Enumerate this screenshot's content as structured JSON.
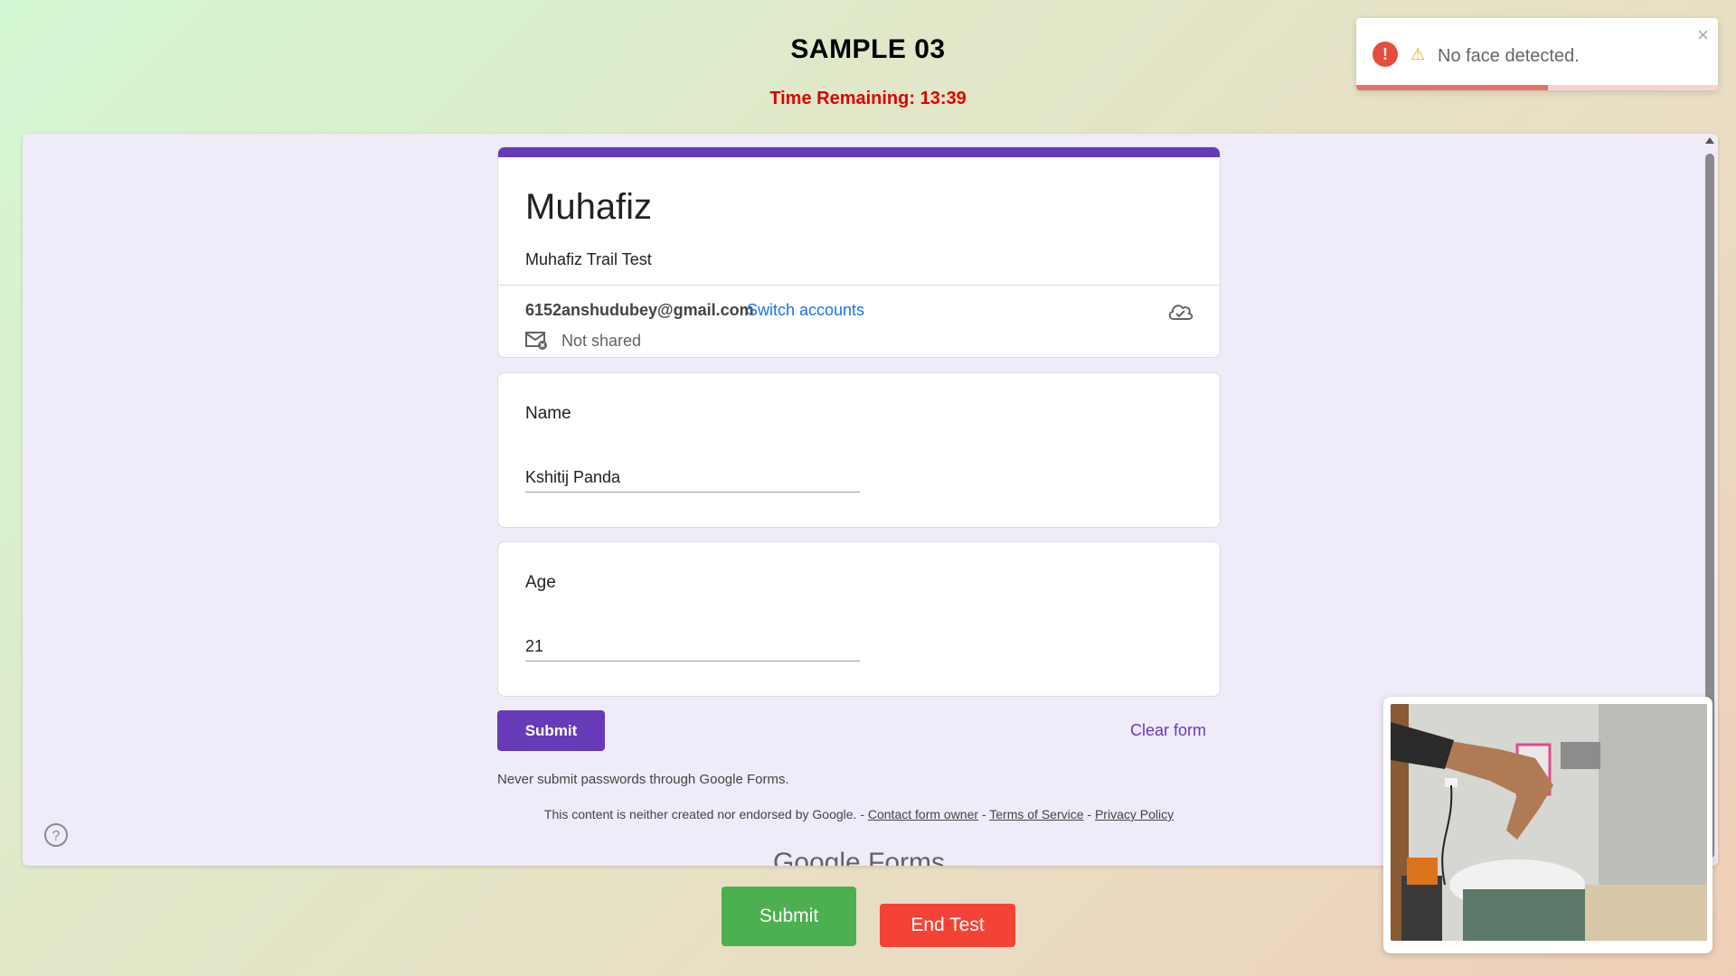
{
  "header": {
    "title": "SAMPLE 03",
    "timer": "Time Remaining: 13:39"
  },
  "toast": {
    "message": "No face detected.",
    "close": "×",
    "error_glyph": "!",
    "warning_glyph": "⚠",
    "progress": 0.53
  },
  "form": {
    "title": "Muhafiz",
    "description": "Muhafiz Trail Test",
    "email": "6152anshudubey@gmail.com",
    "switch_accounts": "Switch accounts",
    "not_shared": "Not shared",
    "questions": [
      {
        "label": "Name",
        "value": "Kshitij Panda"
      },
      {
        "label": "Age",
        "value": "21"
      }
    ],
    "submit_label": "Submit",
    "clear_label": "Clear form",
    "never_submit": "Never submit passwords through Google Forms.",
    "footer_text": "This content is neither created nor endorsed by Google. -",
    "contact_owner": "Contact form owner",
    "terms": "Terms of Service",
    "privacy": "Privacy Policy",
    "sep": "-",
    "brand": "Google Forms"
  },
  "actions": {
    "submit": "Submit",
    "end_test": "End Test"
  },
  "colors": {
    "accent": "#673ab7",
    "submit": "#4caf50",
    "end_test": "#f44336",
    "timer": "#e00000",
    "link": "#1a73e8"
  }
}
